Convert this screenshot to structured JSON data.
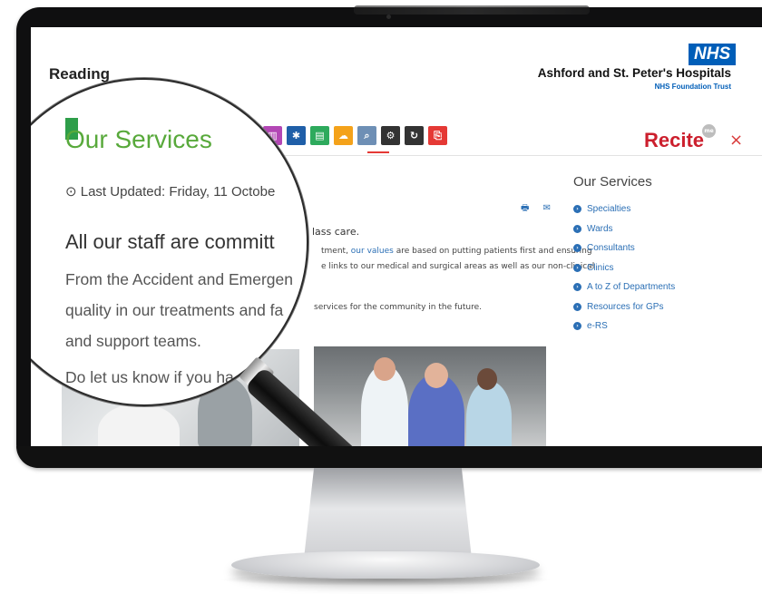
{
  "window": {
    "reading_label": "Reading"
  },
  "brand": {
    "nhs_logo_text": "NHS",
    "hospital_name": "Ashford and St. Peter's Hospitals",
    "trust_name": "NHS Foundation Trust",
    "nhs_blue": "#005eb8"
  },
  "toolbar": {
    "logo": "Recite",
    "logo_badge": "me",
    "close_glyph": "×",
    "accent": "#cc1f2d",
    "icons": [
      "accessibility-badge-icon",
      "dictionary-icon",
      "translate-icon",
      "reading-ruler-icon",
      "download-icon",
      "search-icon",
      "settings-icon",
      "reset-icon",
      "exit-icon"
    ]
  },
  "magnifier": {
    "title": "Our Services",
    "clock_glyph": "⊙",
    "updated": "Last Updated: Friday, 11 Octobe",
    "heading": "All our staff are committ",
    "line1": "From the Accident and Emergen",
    "line2": "quality in our treatments and fa",
    "line3": "and support teams.",
    "line4": "Do let us know if you ha"
  },
  "main": {
    "print_email_glyphs": "🖶 ✉",
    "heading_tail": "lass care.",
    "p1_a": "tment, ",
    "p1_link": "our values",
    "p1_b": " are based on putting patients first and ensuring",
    "p2": "e links to our medical and surgical areas as well as our non-clinical",
    "p3": "services for the community in the future."
  },
  "sidebar": {
    "title": "Our Services",
    "bullet_glyph": "›",
    "items": [
      {
        "label": "Specialties"
      },
      {
        "label": "Wards"
      },
      {
        "label": "Consultants"
      },
      {
        "label": "Clinics"
      },
      {
        "label": "A to Z of Departments"
      },
      {
        "label": "Resources for GPs"
      },
      {
        "label": "e-RS"
      }
    ]
  }
}
